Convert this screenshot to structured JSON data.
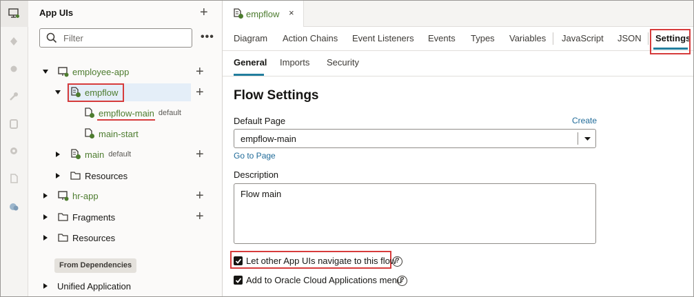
{
  "navigator": {
    "title": "App UIs",
    "filter_placeholder": "Filter",
    "more_label": "•••",
    "add_label": "+",
    "tree": {
      "employee_app": "employee-app",
      "empflow": "empflow",
      "empflow_main": "empflow-main",
      "empflow_main_tag": "default",
      "main_start": "main-start",
      "main": "main",
      "main_tag": "default",
      "resources_inner": "Resources",
      "hr_app": "hr-app",
      "fragments": "Fragments",
      "resources_outer": "Resources"
    },
    "deps_badge": "From Dependencies",
    "unified_application": "Unified Application"
  },
  "editor": {
    "file_tab": "empflow",
    "close_glyph": "×",
    "main_tabs": [
      "Diagram",
      "Action Chains",
      "Event Listeners",
      "Events",
      "Types",
      "Variables",
      "JavaScript",
      "JSON",
      "Settings"
    ],
    "active_main_tab": "Settings",
    "sub_tabs": [
      "General",
      "Imports",
      "Security"
    ],
    "active_sub_tab": "General",
    "section_title": "Flow Settings",
    "default_page_label": "Default Page",
    "create_link": "Create",
    "default_page_value": "empflow-main",
    "go_to_page_link": "Go to Page",
    "description_label": "Description",
    "description_value": "Flow main",
    "checkbox_navigate": "Let other App UIs navigate to this flow",
    "checkbox_menu": "Add to Oracle Cloud Applications menu",
    "help_glyph": "?"
  },
  "colors": {
    "accent": "#227e9e",
    "link": "#1f6a98",
    "tree_label": "#4d7c2f",
    "highlight_box": "#d63b3b",
    "selected_row": "#e4eef8"
  }
}
